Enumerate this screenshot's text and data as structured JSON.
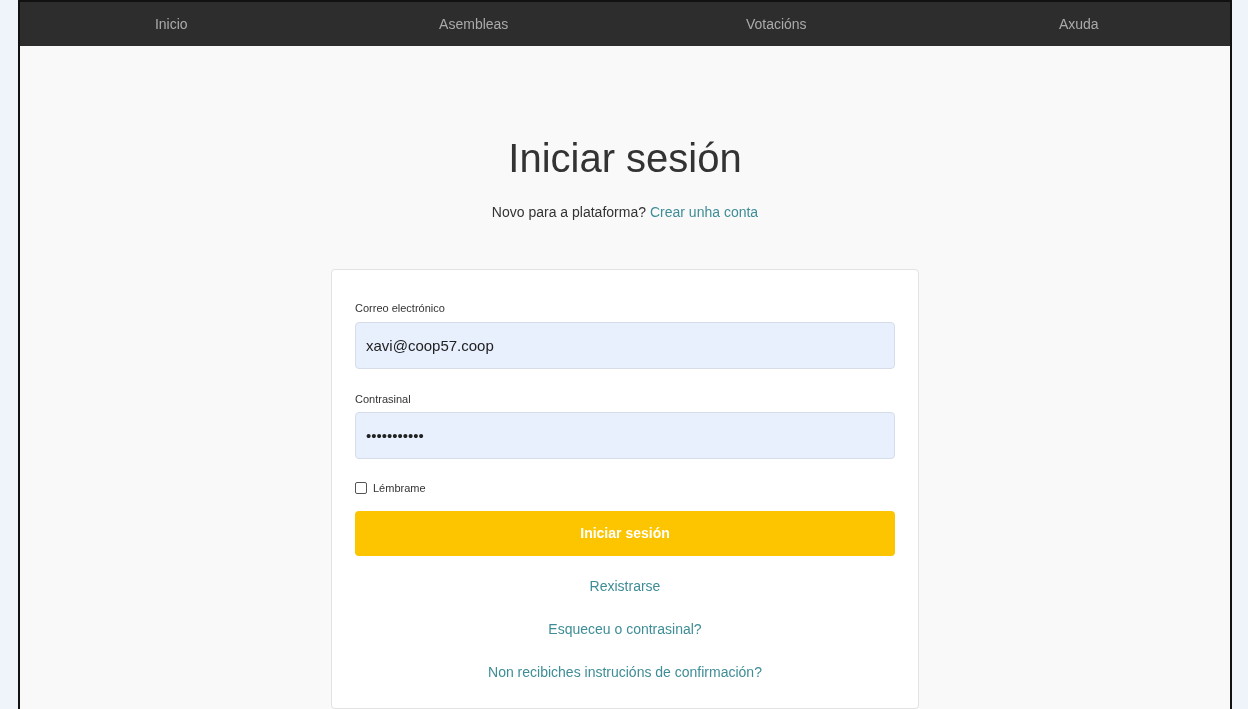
{
  "nav": [
    {
      "label": "Inicio"
    },
    {
      "label": "Asembleas"
    },
    {
      "label": "Votacións"
    },
    {
      "label": "Axuda"
    }
  ],
  "title": "Iniciar sesión",
  "subtitle": {
    "text": "Novo para a plataforma?",
    "link": "Crear unha conta"
  },
  "form": {
    "email_label": "Correo electrónico",
    "email_value": "xavi@coop57.coop",
    "password_label": "Contrasinal",
    "password_value": "•••••••••••",
    "remember": {
      "label": "Lémbrame",
      "checked": false
    },
    "submit": "Iniciar sesión"
  },
  "links": [
    "Rexistrarse",
    "Esqueceu o contrasinal?",
    "Non recibiches instrucións de confirmación?"
  ]
}
